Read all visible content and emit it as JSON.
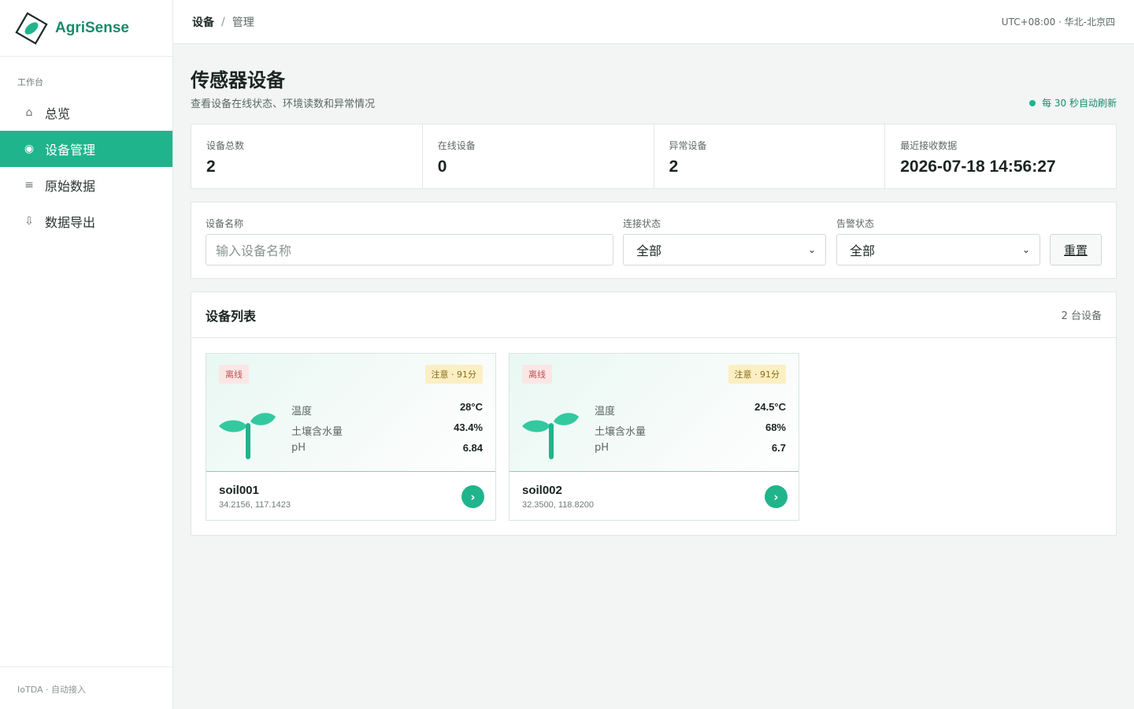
{
  "brand": {
    "name": "AgriSense",
    "logo_icon": "leaf-diamond-icon"
  },
  "sidebar": {
    "section": "工作台",
    "items": [
      {
        "label": "总览",
        "icon": "⌂",
        "active": false
      },
      {
        "label": "设备管理",
        "icon": "◉",
        "active": true
      },
      {
        "label": "原始数据",
        "icon": "≡",
        "active": false
      },
      {
        "label": "数据导出",
        "icon": "⇩",
        "active": false
      }
    ],
    "footer": "IoTDA · 自动接入"
  },
  "topbar": {
    "breadcrumb": [
      "设备",
      "管理"
    ],
    "separator": "/",
    "timezone": "UTC+08:00 · 华北-北京四"
  },
  "page": {
    "title": "传感器设备",
    "subtitle": "查看设备在线状态、环境读数和异常情况",
    "refresh": "每 30 秒自动刷新"
  },
  "stats": [
    {
      "label": "设备总数",
      "value": "2"
    },
    {
      "label": "在线设备",
      "value": "0"
    },
    {
      "label": "异常设备",
      "value": "2"
    },
    {
      "label": "最近接收数据",
      "value": "2026-07-18 14:56:27"
    }
  ],
  "filters": {
    "name_label": "设备名称",
    "name_placeholder": "输入设备名称",
    "conn_label": "连接状态",
    "conn_value": "全部",
    "alarm_label": "告警状态",
    "alarm_value": "全部",
    "reset_label": "重置"
  },
  "list": {
    "title": "设备列表",
    "count": "2 台设备",
    "devices": [
      {
        "status": "离线",
        "alert": "注意 · 91分",
        "metrics": [
          {
            "label": "温度",
            "value": "28°C"
          },
          {
            "label": "土壤含水量",
            "value": "43.4%"
          },
          {
            "label": "pH",
            "value": "6.84"
          }
        ],
        "name": "soil001",
        "coords": "34.2156, 117.1423"
      },
      {
        "status": "离线",
        "alert": "注意 · 91分",
        "metrics": [
          {
            "label": "温度",
            "value": "24.5°C"
          },
          {
            "label": "土壤含水量",
            "value": "68%"
          },
          {
            "label": "pH",
            "value": "6.7"
          }
        ],
        "name": "soil002",
        "coords": "32.3500, 118.8200"
      }
    ]
  },
  "colors": {
    "accent": "#20b48c",
    "brand_text": "#1a8a6c",
    "offline_bg": "#fbe6e6",
    "warn_bg": "#fcefc4"
  }
}
